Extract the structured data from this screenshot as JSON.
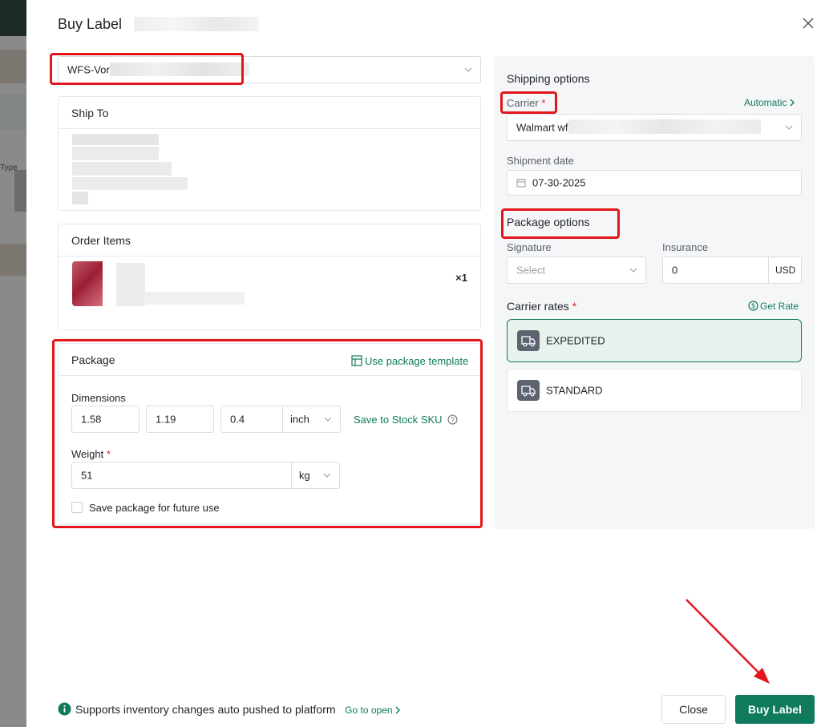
{
  "dialog": {
    "title": "Buy Label",
    "close_label": "Close",
    "buy_label": "Buy Label"
  },
  "warehouse": {
    "value": "WFS-Vor"
  },
  "ship_to": {
    "title": "Ship To"
  },
  "order_items": {
    "title": "Order Items",
    "qty": "×1"
  },
  "package": {
    "title": "Package",
    "template_link": "Use package template",
    "dimensions_label": "Dimensions",
    "length": "1.58",
    "width": "1.19",
    "height": "0.4",
    "dim_unit": "inch",
    "save_sku": "Save to Stock SKU",
    "weight_label": "Weight",
    "required": "*",
    "weight": "51",
    "weight_unit": "kg",
    "save_future": "Save package for future use"
  },
  "shipping": {
    "title": "Shipping options",
    "carrier_label": "Carrier",
    "required": "*",
    "automatic": "Automatic",
    "carrier_value": "Walmart wf",
    "date_label": "Shipment date",
    "date": "07-30-2025"
  },
  "package_options": {
    "title": "Package options",
    "signature_label": "Signature",
    "signature_placeholder": "Select",
    "insurance_label": "Insurance",
    "insurance_value": "0",
    "currency": "USD"
  },
  "rates": {
    "title": "Carrier rates",
    "required": "*",
    "get_rate": "Get Rate",
    "items": [
      {
        "name": "EXPEDITED"
      },
      {
        "name": "STANDARD"
      }
    ]
  },
  "footer": {
    "info": "Supports inventory changes auto pushed to platform",
    "link": "Go to open"
  },
  "background": {
    "text": "Type"
  },
  "colors": {
    "accent": "#0f7a5c",
    "annotation": "#e5161b",
    "required": "#e0262d"
  }
}
